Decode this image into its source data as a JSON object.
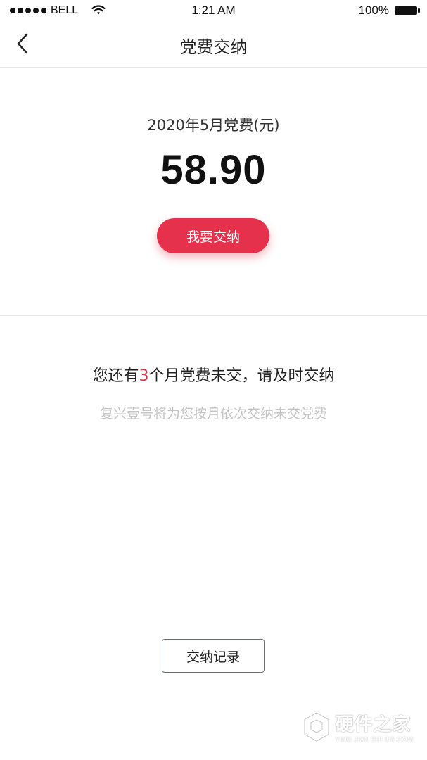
{
  "status_bar": {
    "carrier": "BELL",
    "time": "1:21 AM",
    "battery": "100%"
  },
  "nav": {
    "title": "党费交纳",
    "back_icon": "chevron-left-icon"
  },
  "payment": {
    "period_label": "2020年5月党费(元)",
    "amount": "58.90",
    "pay_button_label": "我要交纳"
  },
  "notice": {
    "prefix": "您还有",
    "unpaid_count": "3",
    "suffix": "个月党费未交，请及时交纳",
    "subtext": "复兴壹号将为您按月依次交纳未交党费"
  },
  "records": {
    "button_label": "交纳记录"
  },
  "watermark": {
    "brand": "硬件之家",
    "sub": "YING JIAN ZHI JIA.COM"
  },
  "colors": {
    "accent": "#e5314b",
    "muted_text": "#c4c4c4",
    "divider": "#e6e6e6"
  }
}
